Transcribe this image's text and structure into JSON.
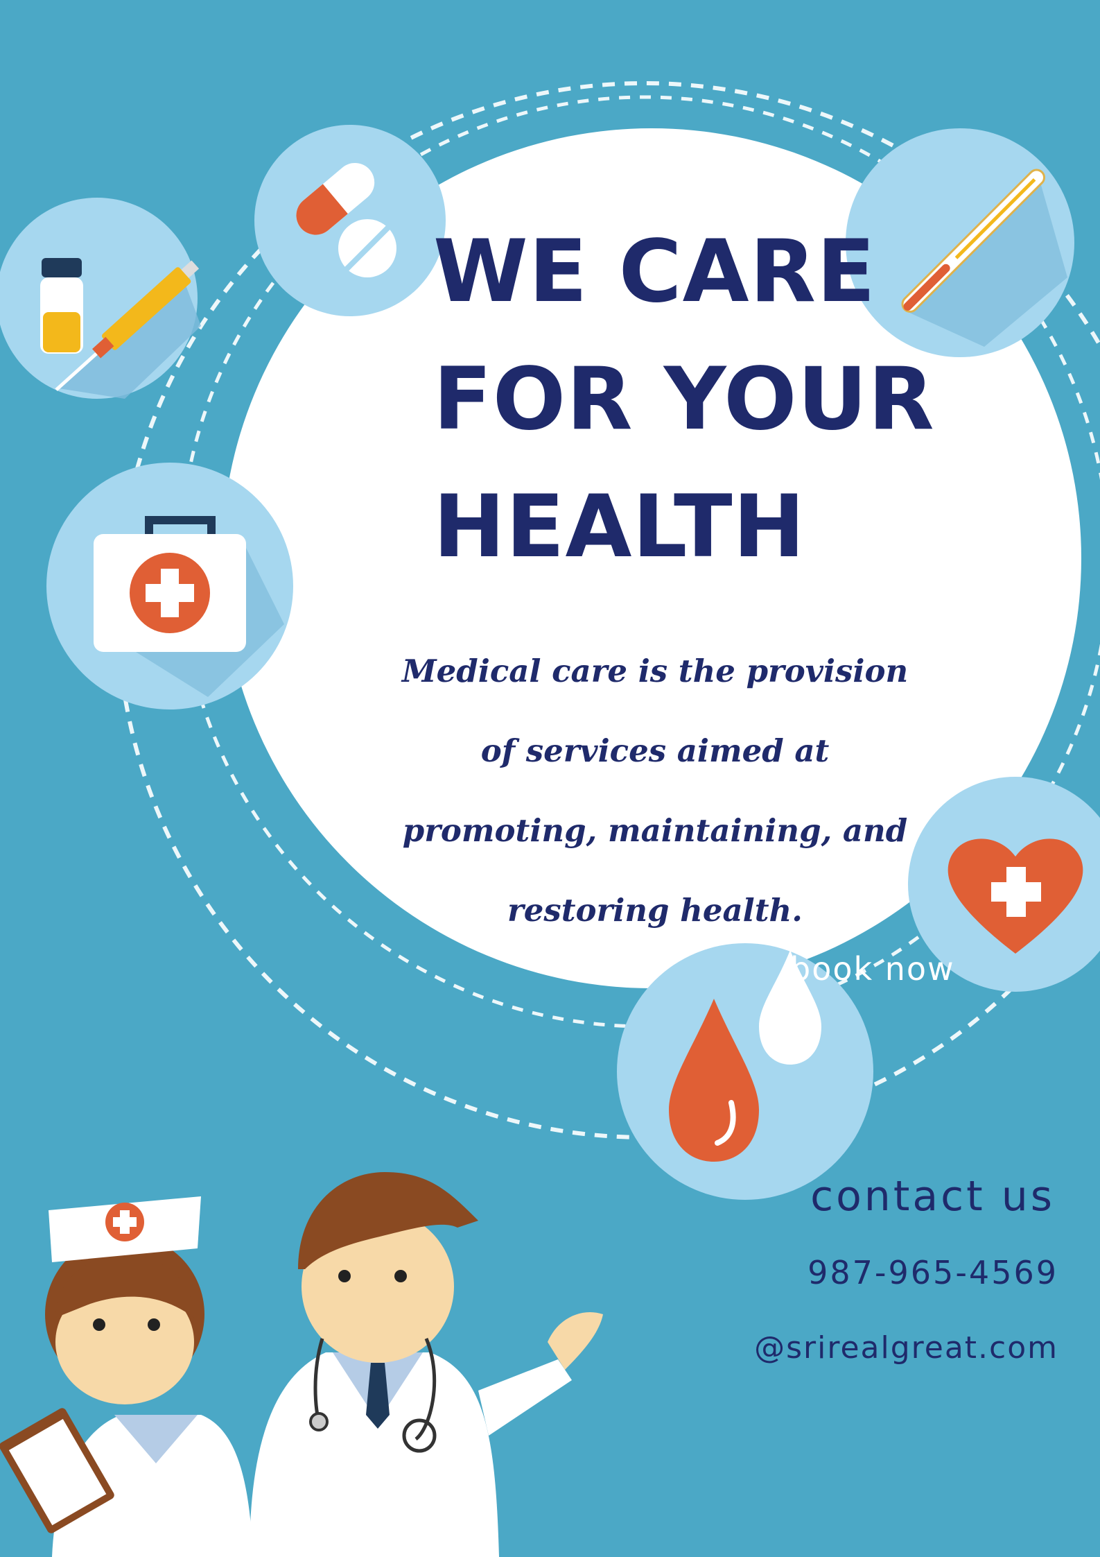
{
  "poster": {
    "headline_lines": [
      "WE CARE",
      "FOR YOUR",
      "HEALTH"
    ],
    "body_text": "Medical care is the provision of services aimed at promoting, maintaining, and restoring health.",
    "book_now_label": "book now",
    "contact": {
      "title": "contact us",
      "phone": "987-965-4569",
      "email": "@srirealgreat.com"
    }
  },
  "colors": {
    "background": "#4ba8c6",
    "circle_fill": "#ffffff",
    "text_dark": "#1f2a6b",
    "icon_badge": "#a6d7ef",
    "accent_red": "#e05f35"
  },
  "icons": [
    "vial-syringe-icon",
    "pills-icon",
    "thermometer-icon",
    "first-aid-kit-icon",
    "heart-cross-icon",
    "blood-drop-icon",
    "nurse-illustration",
    "doctor-illustration"
  ]
}
